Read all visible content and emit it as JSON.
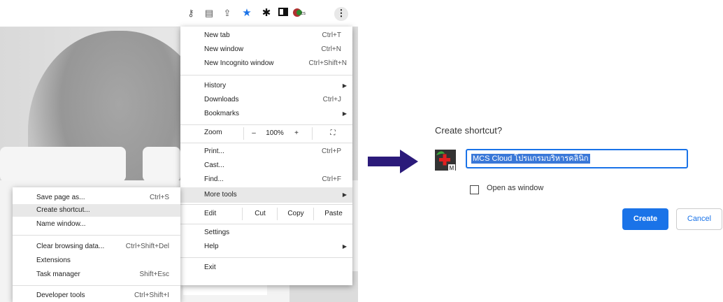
{
  "browser_menu": {
    "items": [
      {
        "label": "New tab",
        "shortcut": "Ctrl+T"
      },
      {
        "label": "New window",
        "shortcut": "Ctrl+N"
      },
      {
        "label": "New Incognito window",
        "shortcut": "Ctrl+Shift+N"
      },
      {
        "label": "History",
        "shortcut": ""
      },
      {
        "label": "Downloads",
        "shortcut": "Ctrl+J"
      },
      {
        "label": "Bookmarks",
        "shortcut": ""
      },
      {
        "label": "Print...",
        "shortcut": "Ctrl+P"
      },
      {
        "label": "Cast...",
        "shortcut": ""
      },
      {
        "label": "Find...",
        "shortcut": "Ctrl+F"
      },
      {
        "label": "More tools",
        "shortcut": ""
      },
      {
        "label": "Settings",
        "shortcut": ""
      },
      {
        "label": "Help",
        "shortcut": ""
      },
      {
        "label": "Exit",
        "shortcut": ""
      }
    ],
    "zoom": {
      "label": "Zoom",
      "minus": "–",
      "value": "100%",
      "plus": "+",
      "fullscreen": "⛶"
    },
    "edit": {
      "label": "Edit",
      "cut": "Cut",
      "copy": "Copy",
      "paste": "Paste"
    }
  },
  "more_tools_menu": {
    "items": [
      {
        "label": "Save page as...",
        "shortcut": "Ctrl+S"
      },
      {
        "label": "Create shortcut...",
        "shortcut": ""
      },
      {
        "label": "Name window...",
        "shortcut": ""
      },
      {
        "label": "Clear browsing data...",
        "shortcut": "Ctrl+Shift+Del"
      },
      {
        "label": "Extensions",
        "shortcut": ""
      },
      {
        "label": "Task manager",
        "shortcut": "Shift+Esc"
      },
      {
        "label": "Developer tools",
        "shortcut": "Ctrl+Shift+I"
      }
    ]
  },
  "toolbar": {
    "icons": [
      "key-icon",
      "translate-icon",
      "share-icon",
      "star-icon",
      "extensions-icon",
      "sidepanel-icon",
      "profile-icon",
      "menu-icon"
    ],
    "star_color": "#1a73e8"
  },
  "dialog": {
    "title": "Create shortcut?",
    "name_value": "MCS Cloud โปรแกรมบริหารคลินิก",
    "checkbox_label": "Open as window",
    "create_label": "Create",
    "cancel_label": "Cancel",
    "accent": "#1a73e8"
  },
  "arrow_color": "#2b1a7a"
}
